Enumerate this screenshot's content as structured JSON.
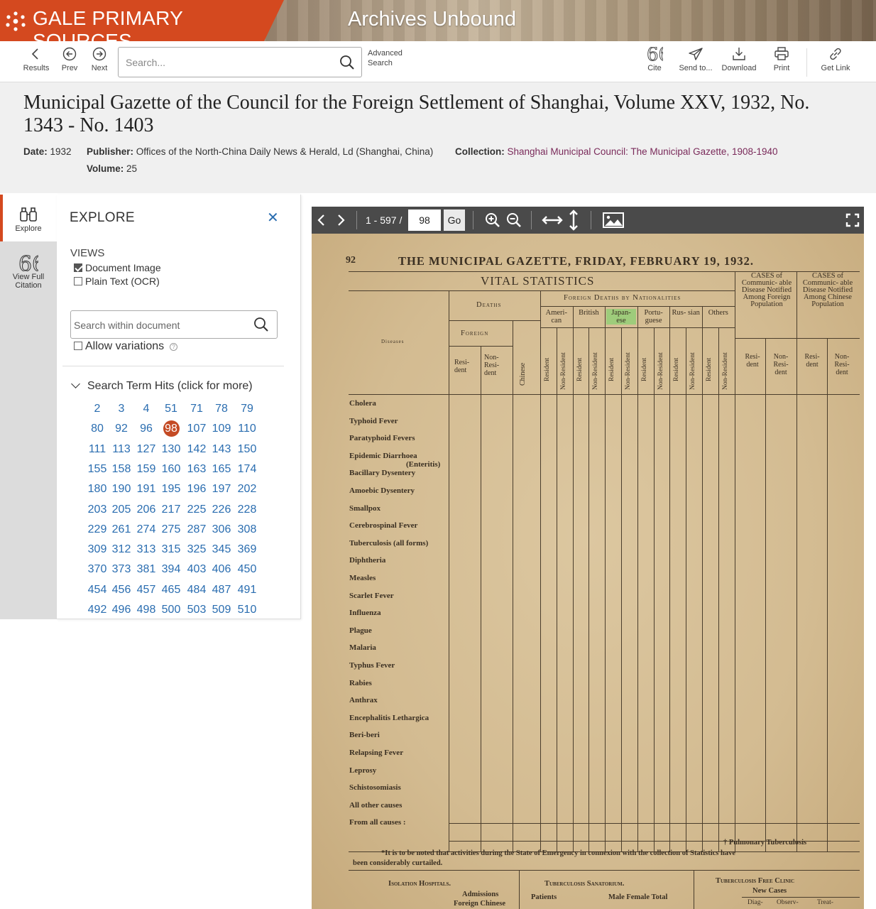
{
  "banner": {
    "brand": "GALE PRIMARY SOURCES",
    "product": "Archives Unbound"
  },
  "toolbar": {
    "results": "Results",
    "prev": "Prev",
    "next": "Next",
    "search_placeholder": "Search...",
    "advanced_line1": "Advanced",
    "advanced_line2": "Search",
    "cite": "Cite",
    "send_to": "Send to...",
    "download": "Download",
    "print": "Print",
    "get_link": "Get Link"
  },
  "document": {
    "title": "Municipal Gazette of the Council for the Foreign Settlement of Shanghai, Volume XXV, 1932, No. 1343 - No. 1403",
    "date_label": "Date:",
    "date": "1932",
    "publisher_label": "Publisher:",
    "publisher": "Offices of the North-China Daily News & Herald, Ld (Shanghai, China)",
    "collection_label": "Collection:",
    "collection": "Shanghai Municipal Council: The Municipal Gazette, 1908-1940",
    "volume_label": "Volume:",
    "volume": "25"
  },
  "rail": {
    "explore": "Explore",
    "citation_line1": "View Full",
    "citation_line2": "Citation"
  },
  "explore": {
    "title": "EXPLORE",
    "views_label": "VIEWS",
    "view_image": "Document Image",
    "view_ocr": "Plain Text (OCR)",
    "within_placeholder": "Search within document",
    "allow_variations": "Allow variations",
    "hits_header": "Search Term Hits (click for more)",
    "hits": [
      [
        "2",
        "3",
        "4",
        "51",
        "71",
        "78",
        "79"
      ],
      [
        "80",
        "92",
        "96",
        "98",
        "107",
        "109",
        "110"
      ],
      [
        "111",
        "113",
        "127",
        "130",
        "142",
        "143",
        "150"
      ],
      [
        "155",
        "158",
        "159",
        "160",
        "163",
        "165",
        "174"
      ],
      [
        "180",
        "190",
        "191",
        "195",
        "196",
        "197",
        "202"
      ],
      [
        "203",
        "205",
        "206",
        "217",
        "225",
        "226",
        "228"
      ],
      [
        "229",
        "261",
        "274",
        "275",
        "287",
        "306",
        "308"
      ],
      [
        "309",
        "312",
        "313",
        "315",
        "325",
        "345",
        "369"
      ],
      [
        "370",
        "373",
        "381",
        "394",
        "403",
        "406",
        "450"
      ],
      [
        "454",
        "456",
        "457",
        "465",
        "484",
        "487",
        "491"
      ],
      [
        "492",
        "496",
        "498",
        "500",
        "503",
        "509",
        "510"
      ]
    ],
    "current_hit": "98"
  },
  "viewer": {
    "page_range": "1 - 597 /",
    "page_value": "98",
    "go": "Go"
  },
  "scan": {
    "page_no": "92",
    "header": "THE MUNICIPAL GAZETTE, FRIDAY, FEBRUARY 19, 1932.",
    "table_title": "VITAL STATISTICS",
    "deaths": "Deaths",
    "foreign_deaths": "Foreign Deaths by Nationalities",
    "foreign": "Foreign",
    "diseases_label": "Diseases",
    "cases_foreign": "CASES of Communic- able Disease Notified Among Foreign Population",
    "cases_chinese": "CASES of Communic- able Disease Notified Among Chinese Population",
    "nationalities": [
      "Ameri- can",
      "British",
      "Japan- ese",
      "Portu- guese",
      "Rus- sian",
      "Others"
    ],
    "resident": "Resi- dent",
    "non_resident": "Non- Resi- dent",
    "chinese": "Chinese",
    "sub_resident": "Resident",
    "sub_non_resident": "Non-Resident",
    "diseases": [
      "Cholera",
      "Typhoid Fever",
      "Paratyphoid Fevers",
      "Epidemic Diarrhoea",
      "(Enteritis)",
      "Bacillary Dysentery",
      "Amoebic Dysentery",
      "Smallpox",
      "Cerebrospinal Fever",
      "Tuberculosis (all forms)",
      "Diphtheria",
      "Measles",
      "Scarlet Fever",
      "Influenza",
      "Plague",
      "Malaria",
      "Typhus Fever",
      "Rabies",
      "Anthrax",
      "Encephalitis Lethargica",
      "Beri-beri",
      "Relapsing Fever",
      "Leprosy",
      "Schistosomiasis",
      "All other causes",
      "From all causes :"
    ],
    "footnote_pul": "† Pulmonary Tuberculosis",
    "footnote_1": "*It is to be noted that activities during the State of Emergency in connexion with the collection of Statistics have",
    "footnote_2": "been considerably curtailed.",
    "isolation": "Isolation Hospitals.",
    "sanatorium": "Tuberculosis Sanatorium.",
    "clinic": "Tuberculosis Free Clinic",
    "admissions": "Admissions",
    "foreign_chinese": "Foreign Chinese",
    "patients": "Patients",
    "male_female": "Male Female Total",
    "new_cases": "New Cases",
    "diag": "Diag-",
    "observ": "Observ-",
    "treat": "Treat-"
  }
}
